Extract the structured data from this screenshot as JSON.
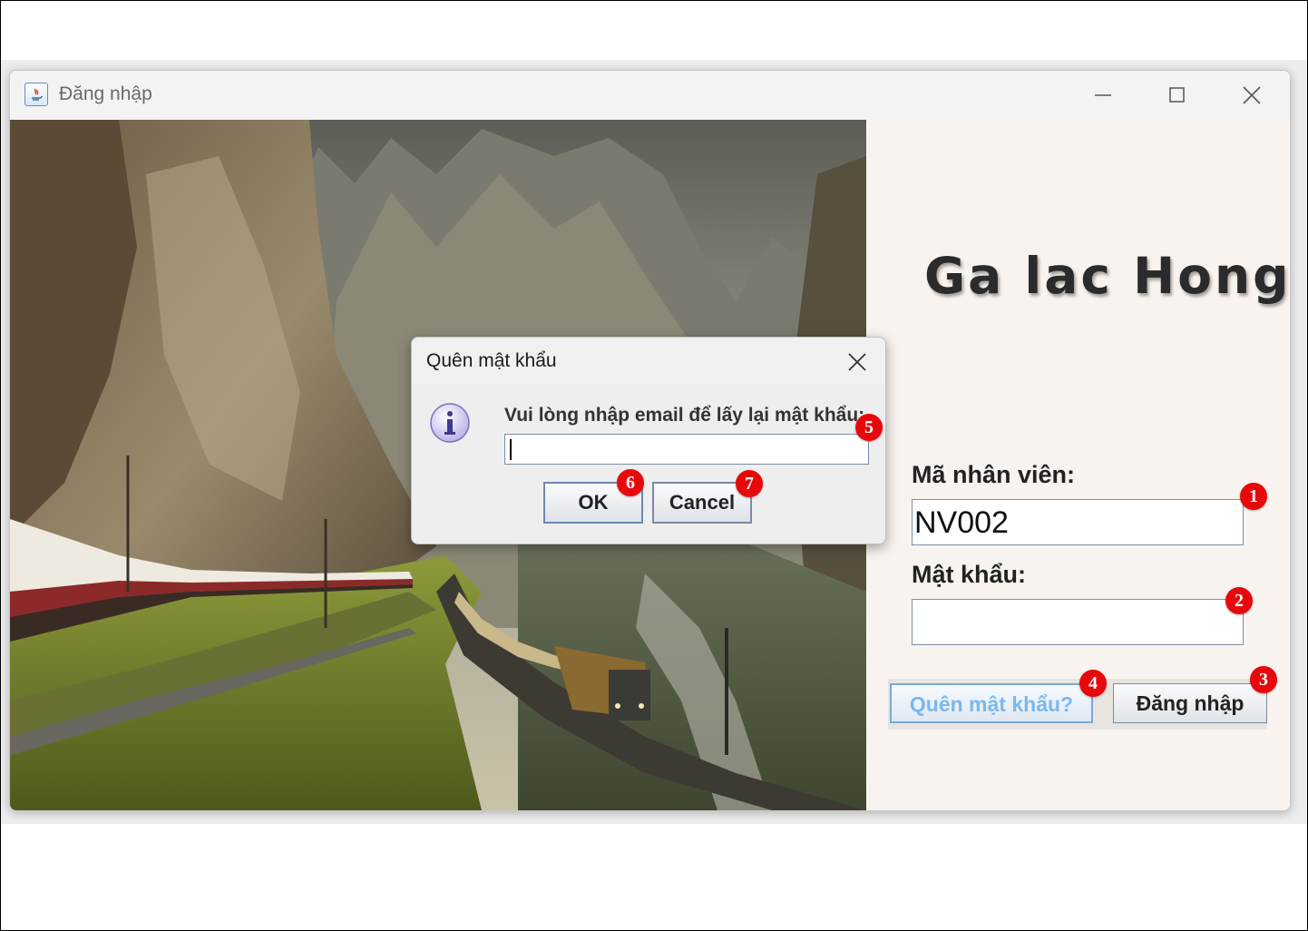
{
  "window": {
    "title": "Đăng nhập",
    "controls": [
      "minimize-icon",
      "maximize-icon",
      "close-icon"
    ]
  },
  "brand": {
    "title": "Ga lac Hong"
  },
  "form": {
    "employee_id_label": "Mã nhân viên:",
    "employee_id_value": "NV002",
    "password_label": "Mật khẩu:",
    "password_value": "",
    "forgot_button": "Quên mật khẩu?",
    "login_button": "Đăng nhập"
  },
  "dialog": {
    "title": "Quên mật khẩu",
    "message": "Vui lòng nhập email để lấy lại mật khẩu:",
    "email_value": "",
    "ok_button": "OK",
    "cancel_button": "Cancel",
    "icon": "info-icon"
  },
  "annotations": {
    "b1": "1",
    "b2": "2",
    "b3": "3",
    "b4": "4",
    "b5": "5",
    "b6": "6",
    "b7": "7",
    "color": "#e8080c"
  },
  "colors": {
    "right_panel_bg": "#f8f3ee",
    "forgot_button_text": "#7ab8ee",
    "title_bar": "#f3f3f3"
  }
}
